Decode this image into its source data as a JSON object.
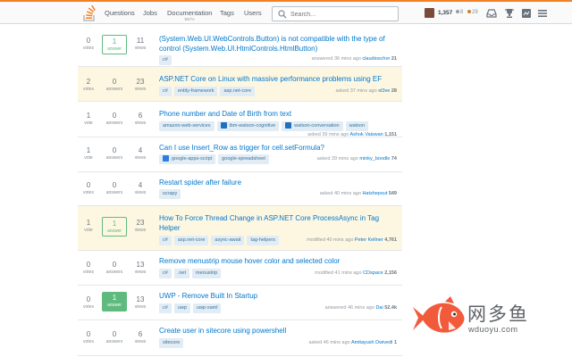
{
  "topbar": {
    "nav": [
      "Questions",
      "Jobs",
      "Documentation",
      "Tags",
      "Users"
    ],
    "beta": "BETA",
    "search_placeholder": "Search...",
    "reputation": "1,357",
    "silver": "8",
    "bronze": "29",
    "colors": {
      "accent": "#f48024",
      "silver": "#9a9c9f",
      "bronze": "#cd7f32"
    }
  },
  "rows": [
    {
      "votes": "0",
      "votes_label": "votes",
      "answers": "1",
      "answers_label": "answer",
      "answer_state": "accepted",
      "views": "11",
      "views_label": "views",
      "title": "(System.Web.UI.WebControls.Button) is not compatible with the type of control (System.Web.UI.HtmlControls.HtmlButton)",
      "tags": [
        {
          "label": "c#"
        }
      ],
      "action": "answered 36 mins ago",
      "user": "claudioschor",
      "rep": "21"
    },
    {
      "votes": "2",
      "votes_label": "votes",
      "answers": "0",
      "answers_label": "answers",
      "answer_state": "none",
      "views": "23",
      "views_label": "views",
      "highlight": true,
      "title": "ASP.NET Core on Linux with massive performance problems using EF",
      "tags": [
        {
          "label": "c#"
        },
        {
          "label": "entity-framework"
        },
        {
          "label": "asp.net-core"
        }
      ],
      "action": "asked 37 mins ago",
      "user": "st3ve",
      "rep": "28"
    },
    {
      "votes": "1",
      "votes_label": "vote",
      "answers": "0",
      "answers_label": "answers",
      "answer_state": "none",
      "views": "6",
      "views_label": "views",
      "title": "Phone number and Date of Birth from text",
      "tags": [
        {
          "label": "amazon-web-services"
        },
        {
          "label": "ibm-watson-cognitive",
          "icon": "watson-icon"
        },
        {
          "label": "watson-conversation",
          "icon": "watson-icon"
        },
        {
          "label": "watson"
        }
      ],
      "action": "asked 39 mins ago",
      "user": "Ashok Vaiswan",
      "rep": "1,151"
    },
    {
      "votes": "1",
      "votes_label": "vote",
      "answers": "0",
      "answers_label": "answers",
      "answer_state": "none",
      "views": "4",
      "views_label": "views",
      "title": "Can I use Insert_Row as trigger for cell.setFormula?",
      "tags": [
        {
          "label": "google-apps-script",
          "icon": "apps-script-icon"
        },
        {
          "label": "google-spreadsheet"
        }
      ],
      "action": "asked 39 mins ago",
      "user": "minky_boodle",
      "rep": "74"
    },
    {
      "votes": "0",
      "votes_label": "votes",
      "answers": "0",
      "answers_label": "answers",
      "answer_state": "none",
      "views": "4",
      "views_label": "views",
      "title": "Restart spider after failure",
      "tags": [
        {
          "label": "scrapy"
        }
      ],
      "action": "asked 40 mins ago",
      "user": "Hatshepsut",
      "rep": "549"
    },
    {
      "votes": "1",
      "votes_label": "vote",
      "answers": "1",
      "answers_label": "answer",
      "answer_state": "accepted",
      "views": "23",
      "views_label": "views",
      "highlight": true,
      "title": "How To Force Thread Change in ASP.NET Core ProcessAsync in Tag Helper",
      "tags": [
        {
          "label": "c#"
        },
        {
          "label": "asp.net-core"
        },
        {
          "label": "async-await"
        },
        {
          "label": "tag-helpers"
        }
      ],
      "action": "modified 40 mins ago",
      "user": "Peter Kellner",
      "rep": "4,761"
    },
    {
      "votes": "0",
      "votes_label": "votes",
      "answers": "0",
      "answers_label": "answers",
      "answer_state": "none",
      "views": "13",
      "views_label": "views",
      "title": "Remove menustrip mouse hover color and selected color",
      "tags": [
        {
          "label": "c#"
        },
        {
          "label": ".net"
        },
        {
          "label": "menustrip"
        }
      ],
      "action": "modified 41 mins ago",
      "user": "CDspace",
      "rep": "2,156"
    },
    {
      "votes": "0",
      "votes_label": "votes",
      "answers": "1",
      "answers_label": "answer",
      "answer_state": "filled",
      "views": "13",
      "views_label": "views",
      "title": "UWP - Remove Built In Startup",
      "tags": [
        {
          "label": "c#"
        },
        {
          "label": "uwp"
        },
        {
          "label": "uwp-xaml"
        }
      ],
      "action": "answered 46 mins ago",
      "user": "Dai",
      "rep": "52.4k"
    },
    {
      "votes": "0",
      "votes_label": "votes",
      "answers": "0",
      "answers_label": "answers",
      "answer_state": "none",
      "views": "6",
      "views_label": "views",
      "title": "Create user in sitecore using powershell",
      "tags": [
        {
          "label": "sitecore"
        }
      ],
      "action": "asked 46 mins ago",
      "user": "Amitayush Dwivedi",
      "rep": "1"
    }
  ],
  "watermark": {
    "text": "网多鱼",
    "url": "wduoyu.com"
  }
}
